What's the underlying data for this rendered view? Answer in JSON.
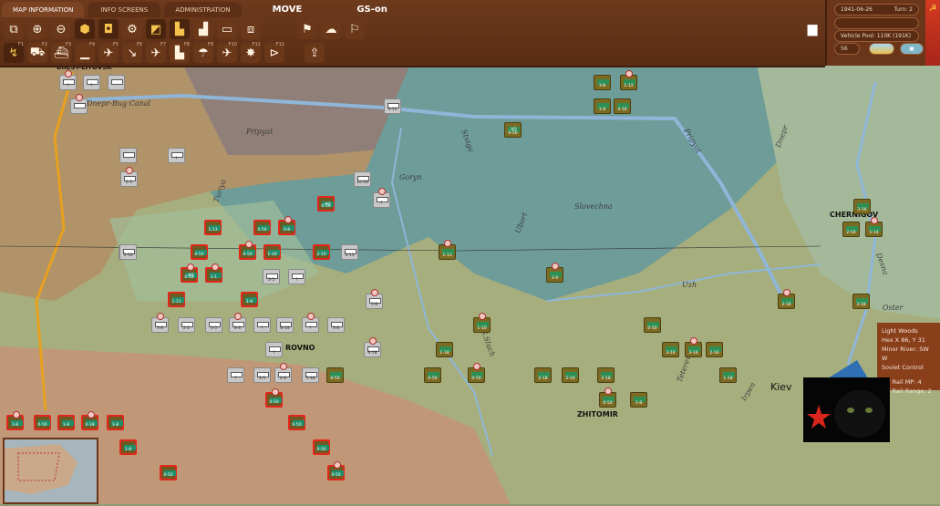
{
  "tabs": [
    "MAP INFORMATION",
    "INFO SCREENS",
    "ADMINISTRATION"
  ],
  "mode": "MOVE",
  "gs": "GS-on",
  "toolbar_row2_keys": [
    "F1",
    "F2",
    "F3",
    "F4",
    "F5",
    "F6",
    "F7",
    "F8",
    "F9",
    "F10",
    "F11",
    "F12"
  ],
  "status": {
    "date": "1941-06-26",
    "turn": "Turn: 2",
    "vehicle_pool": "Vehicle Pool: 110K (191K)",
    "value": "56"
  },
  "hex_info": {
    "terrain": "Light Woods",
    "hex": "Hex X 86, Y 31",
    "river": "Minor River: SW W",
    "control": "Soviet Control",
    "mp": "Off Rail MP: 4",
    "range": "Off Rail Range: 2"
  },
  "map_labels": {
    "brest": "BREST-LITOVSK",
    "canal": "Dnepr-Bug Canal",
    "pripyat": "Pripyat",
    "pripyat2": "Pripyat",
    "goryn": "Goryn",
    "slovechna": "Slovechna",
    "uzh": "Uzh",
    "chernigov": "CHERNIGOV",
    "oster": "Oster",
    "rovno": "ROVNO",
    "zhitomir": "ZHITOMIR",
    "kiev": "Kiev",
    "desna": "Desna",
    "dnepr": "Dnepr",
    "teterev": "Teterev",
    "irpen": "Irpen",
    "sluch": "S.Sluch",
    "ubort": "Ubort",
    "stviga": "Stviga",
    "turiya": "Turiya"
  },
  "counters": [
    {
      "side": "soviet",
      "label": "0-50",
      "hq": true
    },
    {
      "side": "soviet",
      "label": "1-13"
    },
    {
      "side": "soviet",
      "label": "0-50"
    },
    {
      "side": "soviet",
      "label": "0-8"
    },
    {
      "side": "soviet",
      "label": "0-50",
      "hq": true
    },
    {
      "side": "soviet",
      "label": "0-50"
    },
    {
      "side": "soviet",
      "label": "0-50"
    },
    {
      "side": "soviet",
      "label": "1-10"
    },
    {
      "side": "soviet",
      "label": "2-10"
    },
    {
      "side": "soviet",
      "label": "1-1"
    },
    {
      "side": "soviet",
      "label": "1-11"
    },
    {
      "side": "soviet",
      "label": "1-9"
    },
    {
      "side": "soviet",
      "label": "0-50"
    },
    {
      "side": "soviet",
      "label": "0-50"
    },
    {
      "side": "soviet",
      "label": "0-50"
    },
    {
      "side": "soviet",
      "label": "0-50"
    },
    {
      "side": "soviet",
      "label": "0-50"
    },
    {
      "side": "soviet",
      "label": "1-8"
    },
    {
      "side": "soviet",
      "label": "1-8"
    },
    {
      "side": "soviet",
      "label": "0-50"
    },
    {
      "side": "soviet",
      "label": "1-8"
    },
    {
      "side": "soviet",
      "label": "0-18"
    },
    {
      "side": "soviet",
      "label": "1-8"
    },
    {
      "side": "german",
      "label": "5-18"
    },
    {
      "side": "german",
      "label": "?"
    },
    {
      "side": "german",
      "label": "?"
    },
    {
      "side": "german",
      "label": ""
    },
    {
      "side": "german",
      "label": ""
    },
    {
      "side": "german",
      "label": ""
    },
    {
      "side": "german",
      "label": "?"
    },
    {
      "side": "german",
      "label": "2-5"
    },
    {
      "side": "german",
      "label": "3-16"
    },
    {
      "side": "german",
      "label": "3-15"
    },
    {
      "side": "german",
      "label": "5-8"
    },
    {
      "side": "german",
      "label": "3-12"
    },
    {
      "side": "german",
      "label": "10-28"
    },
    {
      "side": "german",
      "label": "?"
    },
    {
      "side": "german",
      "label": "?"
    },
    {
      "side": "german",
      "label": "3-5"
    },
    {
      "side": "german",
      "label": "3-8"
    },
    {
      "side": "german",
      "label": "2-2"
    },
    {
      "side": "german",
      "label": "3-5"
    },
    {
      "side": "german",
      "label": "8-8"
    },
    {
      "side": "german",
      "label": "?"
    },
    {
      "side": "german",
      "label": "8-18"
    },
    {
      "side": "german",
      "label": "?"
    },
    {
      "side": "german",
      "label": "3-8"
    },
    {
      "side": "german",
      "label": "?"
    },
    {
      "side": "german",
      "label": "6-18"
    },
    {
      "side": "german",
      "label": "3-5"
    },
    {
      "side": "german",
      "label": "?"
    },
    {
      "side": "german",
      "label": "2-8"
    },
    {
      "side": "german",
      "label": "5-18"
    },
    {
      "side": "axis",
      "label": "0-50"
    },
    {
      "side": "axis",
      "label": "1-13"
    },
    {
      "side": "axis",
      "label": "0-50",
      "hq": true
    },
    {
      "side": "axis",
      "label": "3-8"
    },
    {
      "side": "axis",
      "label": "1-12"
    },
    {
      "side": "axis",
      "label": "1-8"
    },
    {
      "side": "axis",
      "label": "4-16"
    },
    {
      "side": "axis",
      "label": "1-9"
    },
    {
      "side": "axis",
      "label": "2-18"
    },
    {
      "side": "axis",
      "label": "2-10"
    },
    {
      "side": "axis",
      "label": "1-10"
    },
    {
      "side": "axis",
      "label": "1-18"
    },
    {
      "side": "axis",
      "label": "0-50"
    },
    {
      "side": "axis",
      "label": "0-50"
    },
    {
      "side": "axis",
      "label": "0-50"
    },
    {
      "side": "axis",
      "label": "3-16"
    },
    {
      "side": "axis",
      "label": "3-16"
    },
    {
      "side": "axis",
      "label": "2-16"
    },
    {
      "side": "axis",
      "label": "1-18"
    },
    {
      "side": "axis",
      "label": "2-18"
    },
    {
      "side": "axis",
      "label": "3-18"
    },
    {
      "side": "axis",
      "label": "2-50"
    },
    {
      "side": "axis",
      "label": "1-14"
    },
    {
      "side": "axis",
      "label": "3-16"
    },
    {
      "side": "axis",
      "label": "2-18"
    },
    {
      "side": "axis",
      "label": "0-50"
    },
    {
      "side": "axis",
      "label": "1-8"
    }
  ]
}
